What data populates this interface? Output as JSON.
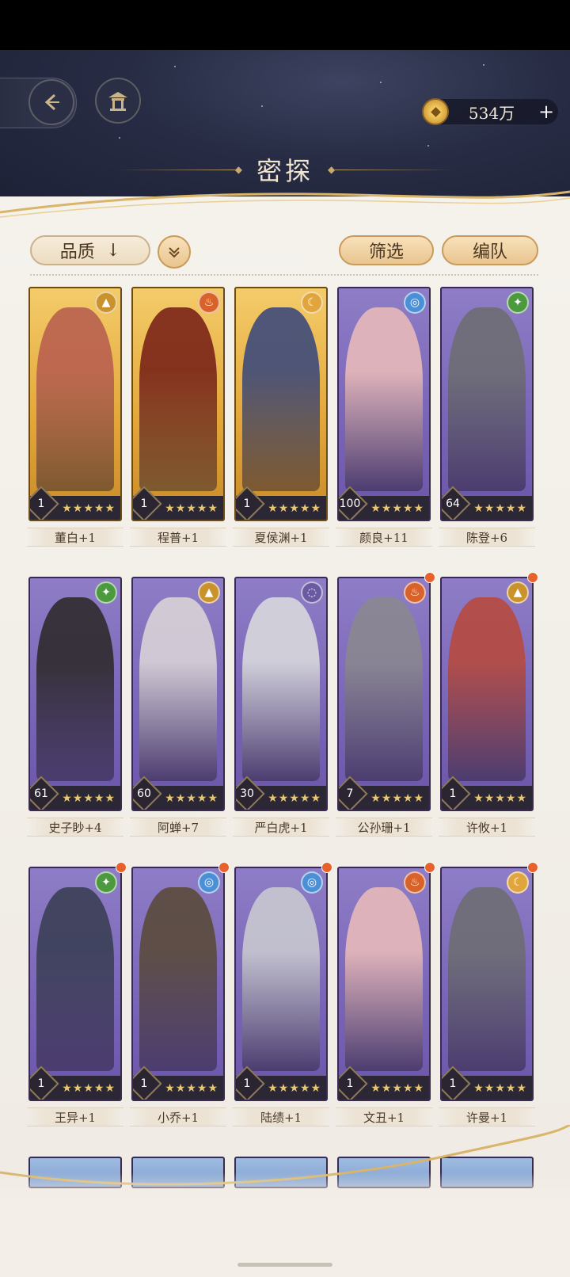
{
  "header": {
    "title": "密探",
    "currency_value": "534万",
    "currency_plus": "+"
  },
  "toolbar": {
    "quality_label": "品质",
    "quality_arrow": "↓",
    "filter_label": "筛选",
    "team_label": "编队"
  },
  "cards": [
    {
      "name": "董白+1",
      "level": "1",
      "frame": "gold",
      "element": "earth-icon",
      "dot": false
    },
    {
      "name": "程普+1",
      "level": "1",
      "frame": "gold",
      "element": "fire-icon",
      "dot": false
    },
    {
      "name": "夏侯渊+1",
      "level": "1",
      "frame": "gold",
      "element": "moon-icon",
      "dot": false
    },
    {
      "name": "颜良+11",
      "level": "100",
      "frame": "purple",
      "element": "water-icon",
      "dot": false
    },
    {
      "name": "陈登+6",
      "level": "64",
      "frame": "purple",
      "element": "wood-icon",
      "dot": false
    },
    {
      "name": "史子眇+4",
      "level": "61",
      "frame": "purple",
      "element": "wood-icon",
      "dot": false
    },
    {
      "name": "阿蝉+7",
      "level": "60",
      "frame": "purple",
      "element": "earth-icon",
      "dot": false
    },
    {
      "name": "严白虎+1",
      "level": "30",
      "frame": "purple",
      "element": "void-icon",
      "dot": false
    },
    {
      "name": "公孙珊+1",
      "level": "7",
      "frame": "purple",
      "element": "fire-icon",
      "dot": true
    },
    {
      "name": "许攸+1",
      "level": "1",
      "frame": "purple",
      "element": "earth-icon",
      "dot": true
    },
    {
      "name": "王异+1",
      "level": "1",
      "frame": "purple",
      "element": "wood-icon",
      "dot": true
    },
    {
      "name": "小乔+1",
      "level": "1",
      "frame": "purple",
      "element": "water-icon",
      "dot": true
    },
    {
      "name": "陆绩+1",
      "level": "1",
      "frame": "purple",
      "element": "water-icon",
      "dot": true
    },
    {
      "name": "文丑+1",
      "level": "1",
      "frame": "purple",
      "element": "fire-icon",
      "dot": true
    },
    {
      "name": "许曼+1",
      "level": "1",
      "frame": "purple",
      "element": "moon-icon",
      "dot": true
    }
  ],
  "colors": {
    "accent_gold": "#e9c58f",
    "panel": "#f5f2ec",
    "header_bg": "#272c44",
    "badge_red": "#e8602a"
  }
}
